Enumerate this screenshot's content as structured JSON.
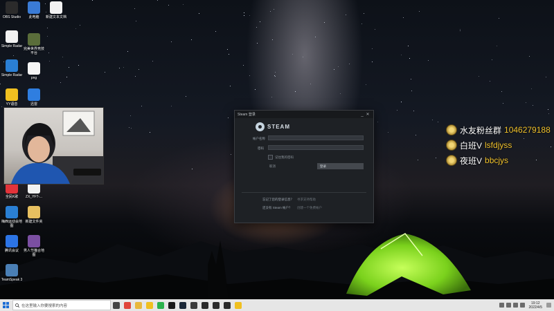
{
  "desktop": {
    "icons": [
      {
        "label": "OBS Studio",
        "icon": "obs-icon",
        "color": "#2b2b2b"
      },
      {
        "label": "此电脑",
        "icon": "computer-icon",
        "color": "#3a7bd5"
      },
      {
        "label": "新建文本文档",
        "icon": "text-file-icon",
        "color": "#f2f2f2"
      },
      {
        "label": "Simple Radar",
        "icon": "file-icon",
        "color": "#f2f2f2"
      },
      {
        "label": "完美世界竞技平台",
        "icon": "perfect-world-icon",
        "color": "#5a6d3a"
      },
      {
        "label": "Simple Radar",
        "icon": "zip-icon",
        "color": "#2a7fd4"
      },
      {
        "label": "png",
        "icon": "image-file-icon",
        "color": "#f5f5f5"
      },
      {
        "label": "YY语音",
        "icon": "yy-icon",
        "color": "#f0c020"
      },
      {
        "label": "迅雷",
        "icon": "xunlei-icon",
        "color": "#2f7ee0"
      },
      {
        "label": "全民K歌",
        "icon": "kge-icon",
        "color": "#e2333a"
      },
      {
        "label": "ZX_YFT-...",
        "icon": "file-icon",
        "color": "#f2f2f2"
      },
      {
        "label": "梅西运动会地图",
        "icon": "zip-icon",
        "color": "#2a7fd4"
      },
      {
        "label": "新建文件夹",
        "icon": "folder-icon",
        "color": "#e8c060"
      },
      {
        "label": "腾讯会议",
        "icon": "tencent-meeting-icon",
        "color": "#2c74e6"
      },
      {
        "label": "男人节猫合地图",
        "icon": "rar-icon",
        "color": "#7b4fa2"
      },
      {
        "label": "TeamSpeak 3",
        "icon": "teamspeak-icon",
        "color": "#4a7fb5"
      }
    ]
  },
  "steam_login": {
    "title": "Steam 登录",
    "minimize": "_",
    "close": "✕",
    "logo_text": "STEAM",
    "account_label": "帐户名称",
    "account_value": "",
    "password_label": "密码",
    "password_value": "",
    "remember_label": "记住我的密码",
    "login_button": "登录",
    "cancel_button": "取消",
    "help_text": "忘记了您的登录信息？",
    "help_link": "寻求支持帮助",
    "create_text": "还没有 Steam 帐户？",
    "create_link": "创建一个免费帐户"
  },
  "overlay": {
    "rows": [
      {
        "label": "水友粉丝群",
        "value": "1046279188"
      },
      {
        "label": "白班V",
        "value": "lsfdjyss"
      },
      {
        "label": "夜班V",
        "value": "bbcjys"
      }
    ]
  },
  "taskbar": {
    "search_placeholder": "在这里输入你要搜索的内容",
    "time": "19:12",
    "date": "2022/4/5",
    "apps": [
      {
        "icon": "task-view-icon",
        "color": "#444444"
      },
      {
        "icon": "chrome-icon",
        "color": "#e0443a"
      },
      {
        "icon": "file-explorer-icon",
        "color": "#e8b83c"
      },
      {
        "icon": "qq-icon",
        "color": "#f0c020"
      },
      {
        "icon": "wechat-icon",
        "color": "#2bb24c"
      },
      {
        "icon": "wegame-icon",
        "color": "#1a1a1a"
      },
      {
        "icon": "steam-icon",
        "color": "#1b2838"
      },
      {
        "icon": "cs-icon",
        "color": "#3a3a3a"
      },
      {
        "icon": "game-icon",
        "color": "#2a2a2a"
      },
      {
        "icon": "obs-icon",
        "color": "#2b2b2b"
      },
      {
        "icon": "game-icon",
        "color": "#2a2a2a"
      },
      {
        "icon": "yy-icon",
        "color": "#f0c020"
      }
    ]
  }
}
